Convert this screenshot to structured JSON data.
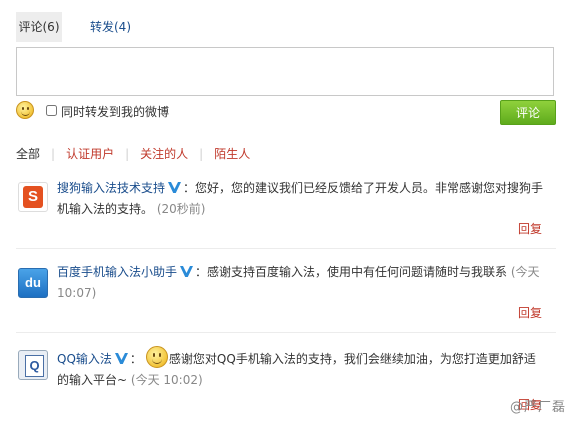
{
  "tabs": {
    "comments": "评论(6)",
    "reposts": "转发(4)"
  },
  "composer": {
    "placeholder": "",
    "repost_label": "同时转发到我的微博",
    "submit_label": "评论"
  },
  "filters": {
    "all": "全部",
    "verified": "认证用户",
    "following": "关注的人",
    "strangers": "陌生人"
  },
  "comments": [
    {
      "author": "搜狗输入法技术支持",
      "text_a": "：您好，您的建议我们已经反馈给了开发人员。非常感谢您对搜狗手机输入法的支持。",
      "text_b": "",
      "time": "(20秒前)",
      "reply": "回复"
    },
    {
      "author": "百度手机输入法小助手",
      "text_a": "：感谢支持百度输入法，使用中有任何问题请随时与我联系",
      "text_b": "",
      "time": "(今天 10:07)",
      "reply": "回复"
    },
    {
      "author": "QQ输入法",
      "text_a": "",
      "text_b": "感谢您对QQ手机输入法的支持，我们会继续加油，为您打造更加舒适的输入平台~",
      "time": "(今天 10:02)",
      "reply": "回复"
    }
  ],
  "watermark": "@严厂磊",
  "colors": {
    "link_blue": "#1a4d8c",
    "red": "#c0392b",
    "submit_green": "#6bbf22"
  }
}
